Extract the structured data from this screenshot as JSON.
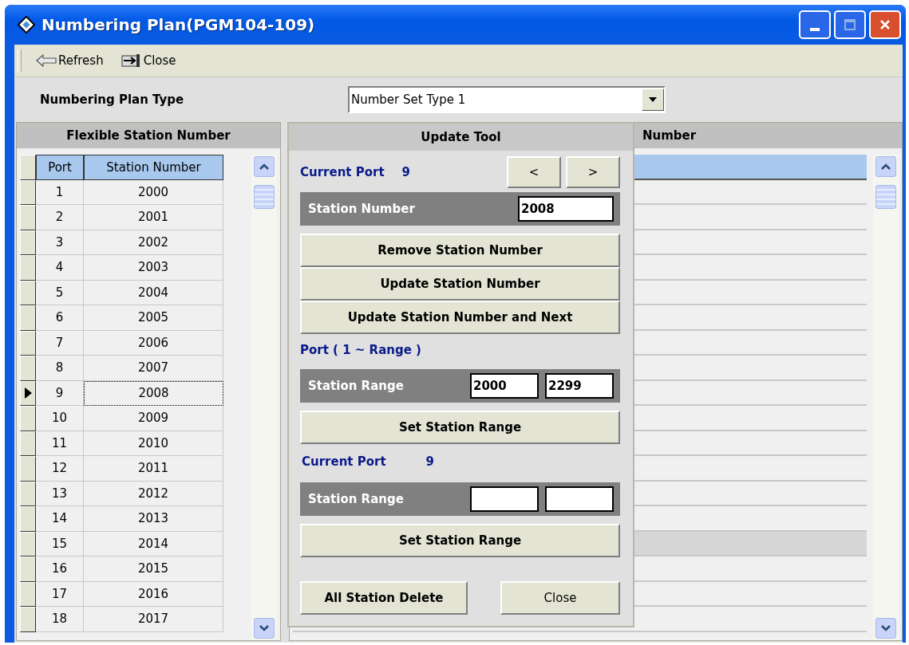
{
  "window": {
    "title": "Numbering Plan(PGM104-109)"
  },
  "toolbar": [
    {
      "kind": "refresh",
      "label": "Refresh"
    },
    {
      "kind": "close",
      "label": "Close"
    }
  ],
  "plan_type": {
    "label": "Numbering Plan Type",
    "value": "Number Set Type 1"
  },
  "left_panel": {
    "title": "Flexible Station Number",
    "columns": [
      "Port",
      "Station Number"
    ],
    "rows": [
      {
        "port": "1",
        "station": "2000",
        "selected": false
      },
      {
        "port": "2",
        "station": "2001",
        "selected": false
      },
      {
        "port": "3",
        "station": "2002",
        "selected": false
      },
      {
        "port": "4",
        "station": "2003",
        "selected": false
      },
      {
        "port": "5",
        "station": "2004",
        "selected": false
      },
      {
        "port": "6",
        "station": "2005",
        "selected": false
      },
      {
        "port": "7",
        "station": "2006",
        "selected": false
      },
      {
        "port": "8",
        "station": "2007",
        "selected": false
      },
      {
        "port": "9",
        "station": "2008",
        "selected": true
      },
      {
        "port": "10",
        "station": "2009",
        "selected": false
      },
      {
        "port": "11",
        "station": "2010",
        "selected": false
      },
      {
        "port": "12",
        "station": "2011",
        "selected": false
      },
      {
        "port": "13",
        "station": "2012",
        "selected": false
      },
      {
        "port": "14",
        "station": "2013",
        "selected": false
      },
      {
        "port": "15",
        "station": "2014",
        "selected": false
      },
      {
        "port": "16",
        "station": "2015",
        "selected": false
      },
      {
        "port": "17",
        "station": "2016",
        "selected": false
      },
      {
        "port": "18",
        "station": "2017",
        "selected": false
      }
    ]
  },
  "right_panel": {
    "title": "Number",
    "rows": [
      {
        "selected": true,
        "shaded": false
      },
      {
        "selected": false,
        "shaded": false
      },
      {
        "selected": false,
        "shaded": false
      },
      {
        "selected": false,
        "shaded": false
      },
      {
        "selected": false,
        "shaded": false
      },
      {
        "selected": false,
        "shaded": false
      },
      {
        "selected": false,
        "shaded": false
      },
      {
        "selected": false,
        "shaded": false
      },
      {
        "selected": false,
        "shaded": false
      },
      {
        "selected": false,
        "shaded": false
      },
      {
        "selected": false,
        "shaded": false
      },
      {
        "selected": false,
        "shaded": false
      },
      {
        "selected": false,
        "shaded": false
      },
      {
        "selected": false,
        "shaded": false
      },
      {
        "selected": false,
        "shaded": false
      },
      {
        "selected": false,
        "shaded": true
      },
      {
        "selected": false,
        "shaded": false
      },
      {
        "selected": false,
        "shaded": false
      },
      {
        "selected": false,
        "shaded": false
      }
    ]
  },
  "update_tool": {
    "title": "Update Tool",
    "current_port": {
      "label": "Current Port",
      "value": "9"
    },
    "prev_button": "<",
    "next_button": ">",
    "station_number": {
      "label": "Station Number",
      "value": "2008"
    },
    "buttons": [
      "Remove Station Number",
      "Update Station Number",
      "Update Station Number and Next"
    ],
    "range_title": "Port ( 1 ~ Range )",
    "range": {
      "label": "Station Range",
      "from": "2000",
      "to": "2299"
    },
    "set_range_button": "Set Station Range",
    "current_port_2": {
      "label": "Current Port",
      "value": "9"
    },
    "range_2": {
      "label": "Station Range"
    },
    "set_range_button_2": "Set Station Range",
    "delete_all_button": "All Station Delete",
    "close_button": "Close"
  }
}
